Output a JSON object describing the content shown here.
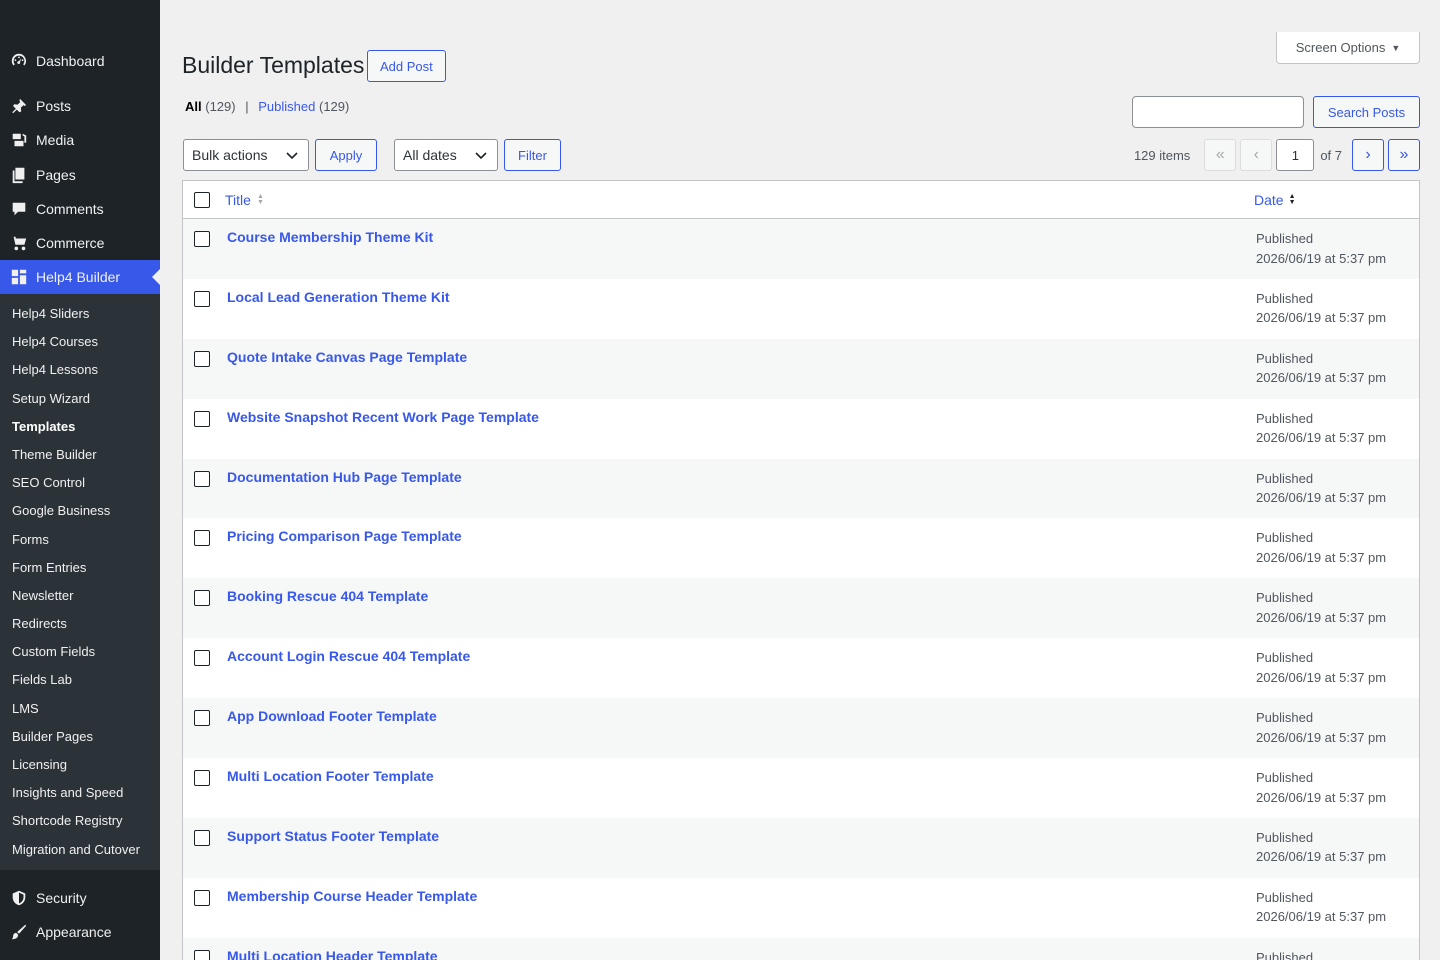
{
  "sidebar": {
    "top_items": [
      {
        "label": "Dashboard",
        "icon": "dashboard-icon"
      },
      {
        "label": "Posts",
        "icon": "pin-icon"
      },
      {
        "label": "Media",
        "icon": "media-icon"
      },
      {
        "label": "Pages",
        "icon": "pages-icon"
      },
      {
        "label": "Comments",
        "icon": "comment-icon"
      },
      {
        "label": "Commerce",
        "icon": "cart-icon"
      },
      {
        "label": "Help4 Builder",
        "icon": "grid-icon"
      }
    ],
    "sub_items": [
      "Help4 Sliders",
      "Help4 Courses",
      "Help4 Lessons",
      "Setup Wizard",
      "Templates",
      "Theme Builder",
      "SEO Control",
      "Google Business",
      "Forms",
      "Form Entries",
      "Newsletter",
      "Redirects",
      "Custom Fields",
      "Fields Lab",
      "LMS",
      "Builder Pages",
      "Licensing",
      "Insights and Speed",
      "Shortcode Registry",
      "Migration and Cutover"
    ],
    "bottom_items": [
      {
        "label": "Security",
        "icon": "shield-icon"
      },
      {
        "label": "Appearance",
        "icon": "brush-icon"
      }
    ]
  },
  "header": {
    "screen_options": "Screen Options",
    "title": "Builder Templates",
    "add_button": "Add Post"
  },
  "views": {
    "all_label": "All",
    "all_count": "(129)",
    "separator": "|",
    "published_label": "Published",
    "published_count": "(129)"
  },
  "search": {
    "button": "Search Posts",
    "value": ""
  },
  "tablenav": {
    "bulk_actions": "Bulk actions",
    "apply": "Apply",
    "dates": "All dates",
    "filter": "Filter",
    "items": "129 items",
    "first": "«",
    "prev": "‹",
    "current_page": "1",
    "of_pages": "of 7",
    "next": "›",
    "last": "»"
  },
  "table": {
    "col_title": "Title",
    "col_date": "Date",
    "rows": [
      {
        "title": "Course Membership Theme Kit",
        "status": "Published",
        "date": "2026/06/19 at 5:37 pm"
      },
      {
        "title": "Local Lead Generation Theme Kit",
        "status": "Published",
        "date": "2026/06/19 at 5:37 pm"
      },
      {
        "title": "Quote Intake Canvas Page Template",
        "status": "Published",
        "date": "2026/06/19 at 5:37 pm"
      },
      {
        "title": "Website Snapshot Recent Work Page Template",
        "status": "Published",
        "date": "2026/06/19 at 5:37 pm"
      },
      {
        "title": "Documentation Hub Page Template",
        "status": "Published",
        "date": "2026/06/19 at 5:37 pm"
      },
      {
        "title": "Pricing Comparison Page Template",
        "status": "Published",
        "date": "2026/06/19 at 5:37 pm"
      },
      {
        "title": "Booking Rescue 404 Template",
        "status": "Published",
        "date": "2026/06/19 at 5:37 pm"
      },
      {
        "title": "Account Login Rescue 404 Template",
        "status": "Published",
        "date": "2026/06/19 at 5:37 pm"
      },
      {
        "title": "App Download Footer Template",
        "status": "Published",
        "date": "2026/06/19 at 5:37 pm"
      },
      {
        "title": "Multi Location Footer Template",
        "status": "Published",
        "date": "2026/06/19 at 5:37 pm"
      },
      {
        "title": "Support Status Footer Template",
        "status": "Published",
        "date": "2026/06/19 at 5:37 pm"
      },
      {
        "title": "Membership Course Header Template",
        "status": "Published",
        "date": "2026/06/19 at 5:37 pm"
      },
      {
        "title": "Multi Location Header Template",
        "status": "Published",
        "date": ""
      }
    ]
  }
}
